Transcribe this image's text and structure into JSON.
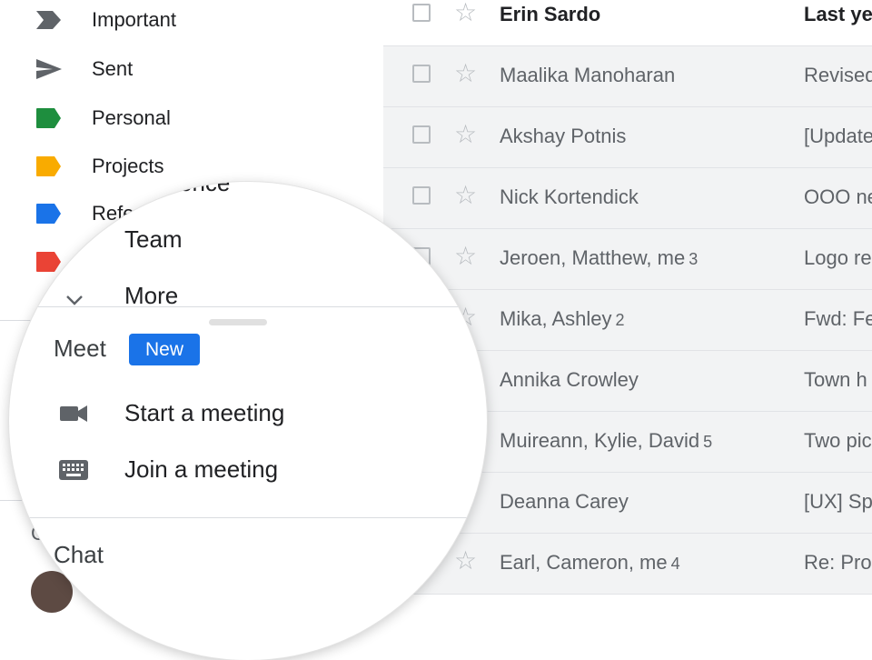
{
  "sidebar": {
    "items": [
      {
        "label": "Important",
        "icon": "important-icon",
        "color": "#5f6368"
      },
      {
        "label": "Sent",
        "icon": "send-icon",
        "color": "#5f6368"
      },
      {
        "label": "Personal",
        "icon": "label-icon",
        "color": "#1e8e3e"
      },
      {
        "label": "Projects",
        "icon": "label-icon",
        "color": "#f9ab00"
      },
      {
        "label": "Refe",
        "icon": "label-icon",
        "color": "#1a73e8"
      },
      {
        "label": "",
        "icon": "label-icon",
        "color": "#ea4335"
      }
    ],
    "chat_letter": "C"
  },
  "mail_list": {
    "header": {
      "sender": "Erin Sardo",
      "subject": "Last ye"
    },
    "rows": [
      {
        "sender": "Maalika Manoharan",
        "count": "",
        "subject": "Revised"
      },
      {
        "sender": "Akshay Potnis",
        "count": "",
        "subject": "[Update"
      },
      {
        "sender": "Nick Kortendick",
        "count": "",
        "subject": "OOO ne"
      },
      {
        "sender": "Jeroen, Matthew, me",
        "count": "3",
        "subject": "Logo re"
      },
      {
        "sender": "Mika, Ashley",
        "count": "2",
        "subject": "Fwd: Fe"
      },
      {
        "sender": "Annika Crowley",
        "count": "",
        "subject": "Town h"
      },
      {
        "sender": "Muireann, Kylie, David",
        "count": "5",
        "subject": "Two pic"
      },
      {
        "sender": "Deanna Carey",
        "count": "",
        "subject": "[UX] Sp"
      },
      {
        "sender": "Earl, Cameron, me",
        "count": "4",
        "subject": "Re: Pro"
      }
    ]
  },
  "magnifier": {
    "cut_label": "ence",
    "team_label": "Team",
    "more_label": "More",
    "meet_title": "Meet",
    "new_badge": "New",
    "start_meeting": "Start a meeting",
    "join_meeting": "Join a meeting",
    "chat_title": "Chat",
    "accent_color": "#1a73e8"
  }
}
